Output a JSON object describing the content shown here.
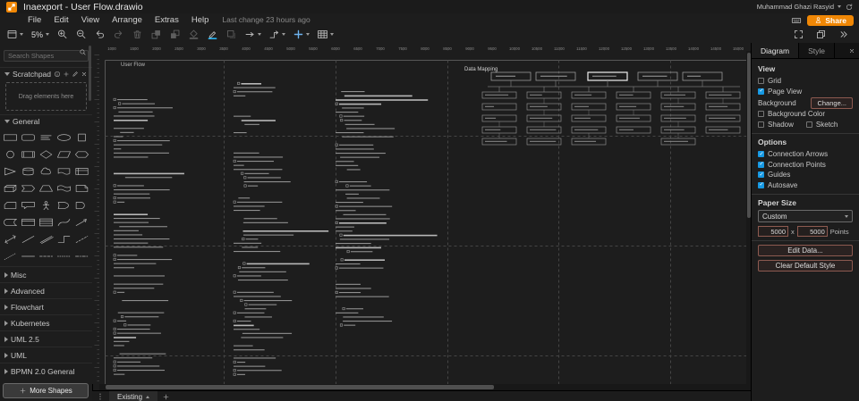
{
  "titlebar": {
    "title": "Inaexport - User Flow.drawio",
    "user_name": "Muhammad Ghazi Rasyid",
    "share_label": "Share"
  },
  "menubar": {
    "items": [
      "File",
      "Edit",
      "View",
      "Arrange",
      "Extras",
      "Help"
    ],
    "last_change": "Last change 23 hours ago"
  },
  "toolbar": {
    "zoom": "5%",
    "items": [
      {
        "name": "pages-icon",
        "icon": "pages",
        "caret": true
      },
      {
        "name": "zoom-display",
        "zoom": true,
        "caret": true
      },
      {
        "name": "zoom-in-icon",
        "icon": "zoom-in"
      },
      {
        "name": "zoom-out-icon",
        "icon": "zoom-out"
      },
      {
        "name": "undo-icon",
        "icon": "undo"
      },
      {
        "name": "redo-icon",
        "icon": "redo",
        "dim": true
      },
      {
        "name": "delete-icon",
        "icon": "trash",
        "dim": true
      },
      {
        "name": "to-front-icon",
        "icon": "tofront",
        "dim": true
      },
      {
        "name": "to-back-icon",
        "icon": "toback",
        "dim": true
      },
      {
        "name": "fill-color-icon",
        "icon": "fill-color",
        "dim": true
      },
      {
        "name": "line-color-icon",
        "icon": "line-color"
      },
      {
        "name": "shadow-icon",
        "icon": "shadow",
        "dim": true
      },
      {
        "name": "arrow-style-icon",
        "icon": "arrow-style",
        "caret": true
      },
      {
        "name": "waypoints-icon",
        "icon": "waypoints",
        "caret": true
      },
      {
        "name": "insert-icon",
        "icon": "insert",
        "caret": true
      },
      {
        "name": "table-icon",
        "icon": "table",
        "caret": true
      }
    ],
    "right_items": [
      {
        "name": "fullscreen-icon",
        "icon": "fullscreen"
      },
      {
        "name": "restore-icon",
        "icon": "restore"
      },
      {
        "name": "collapse-panel-icon",
        "icon": "chevrons-right"
      }
    ]
  },
  "sidebar": {
    "search_placeholder": "Search Shapes",
    "scratchpad": {
      "title": "Scratchpad",
      "drop_hint": "Drag elements here"
    },
    "shape_sections": [
      {
        "label": "General",
        "expanded": true
      },
      {
        "label": "Misc",
        "expanded": false
      },
      {
        "label": "Advanced",
        "expanded": false
      },
      {
        "label": "Flowchart",
        "expanded": false
      },
      {
        "label": "Kubernetes",
        "expanded": false
      },
      {
        "label": "UML 2.5",
        "expanded": false
      },
      {
        "label": "UML",
        "expanded": false
      },
      {
        "label": "BPMN 2.0 General",
        "expanded": false
      }
    ],
    "general_shapes": [
      "rectangle",
      "rounded-rectangle",
      "text",
      "ellipse",
      "square",
      "circle",
      "process",
      "diamond",
      "parallelogram",
      "hexagon",
      "triangle",
      "cylinder",
      "cloud",
      "document",
      "internal-storage",
      "cube",
      "step",
      "trapezoid",
      "tape",
      "note",
      "card",
      "callout",
      "actor",
      "or",
      "and",
      "data-storage",
      "container",
      "list",
      "curve",
      "arrow",
      "bidirectional-arrow",
      "line",
      "link-edge",
      "elbow-edge",
      "dashed-line",
      "dotted-line",
      "horizontal-line",
      "horizontal-dashed-line",
      "horizontal-dotted-line",
      "horizontal-dash-dot-line"
    ],
    "more_shapes_label": "More Shapes"
  },
  "canvas": {
    "diagram_labels": {
      "user_flow": "User Flow",
      "data_mapping": "Data Mapping"
    },
    "ruler": {
      "unit_start": 1000,
      "unit_step": 500
    }
  },
  "format_panel": {
    "tabs": [
      {
        "label": "Diagram",
        "active": true
      },
      {
        "label": "Style",
        "active": false
      }
    ],
    "sections": {
      "view": {
        "title": "View",
        "checkboxes": [
          {
            "label": "Grid",
            "checked": false
          },
          {
            "label": "Page View",
            "checked": true
          }
        ],
        "background_label": "Background",
        "change_button_label": "Change...",
        "checkboxes_2": [
          {
            "label": "Background Color",
            "checked": false
          }
        ],
        "checkboxes_row": [
          {
            "label": "Shadow",
            "checked": false
          },
          {
            "label": "Sketch",
            "checked": false
          }
        ]
      },
      "options": {
        "title": "Options",
        "checkboxes": [
          {
            "label": "Connection Arrows",
            "checked": true
          },
          {
            "label": "Connection Points",
            "checked": true
          },
          {
            "label": "Guides",
            "checked": true
          },
          {
            "label": "Autosave",
            "checked": true
          }
        ]
      },
      "paper_size": {
        "title": "Paper Size",
        "selected": "Custom",
        "width": "5000",
        "height": "5000",
        "separator": "x",
        "unit_label": "Points"
      }
    },
    "buttons": {
      "edit_data": "Edit Data...",
      "clear_default_style": "Clear Default Style"
    }
  },
  "footer": {
    "page_tab": "Existing"
  }
}
